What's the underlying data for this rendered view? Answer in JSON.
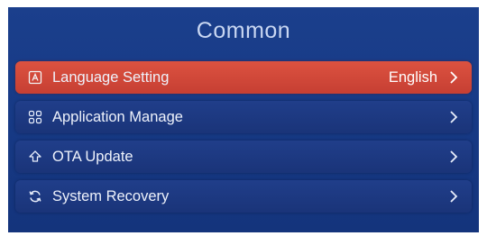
{
  "screen": {
    "title": "Common"
  },
  "menu": {
    "items": [
      {
        "label": "Language Setting",
        "value": "English",
        "icon": "language-icon",
        "selected": true
      },
      {
        "label": "Application Manage",
        "value": "",
        "icon": "apps-grid-icon",
        "selected": false
      },
      {
        "label": "OTA Update",
        "value": "",
        "icon": "update-upload-icon",
        "selected": false
      },
      {
        "label": "System Recovery",
        "value": "",
        "icon": "recovery-icon",
        "selected": false
      }
    ]
  },
  "colors": {
    "background": "#173a86",
    "row": "#1d3a82",
    "selected_row": "#d2483a",
    "text": "#eef2fb",
    "title": "#c9d7f2"
  }
}
